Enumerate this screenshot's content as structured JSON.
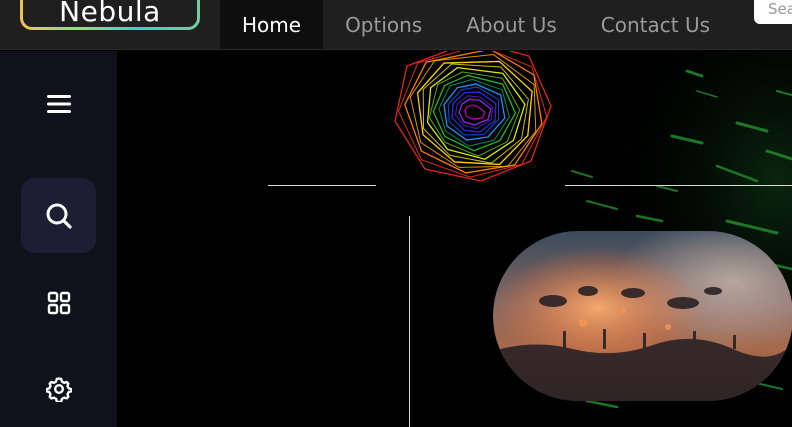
{
  "brand": {
    "name": "Nebula"
  },
  "nav": {
    "items": [
      {
        "label": "Home",
        "active": true
      },
      {
        "label": "Options",
        "active": false
      },
      {
        "label": "About Us",
        "active": false
      },
      {
        "label": "Contact Us",
        "active": false
      }
    ]
  },
  "search": {
    "placeholder": "Search"
  },
  "sidebar": {
    "items": [
      {
        "icon": "menu-icon",
        "active": false
      },
      {
        "icon": "search-icon",
        "active": true
      },
      {
        "icon": "grid-icon",
        "active": false
      },
      {
        "icon": "gear-icon",
        "active": false
      }
    ]
  },
  "colors": {
    "topbar_bg": "#1f1f1f",
    "sidebar_bg": "#11111b",
    "sidebar_active": "#1e1d33",
    "main_bg": "#000000",
    "text_active": "#ffffff",
    "text_muted": "#9a9a9a"
  }
}
